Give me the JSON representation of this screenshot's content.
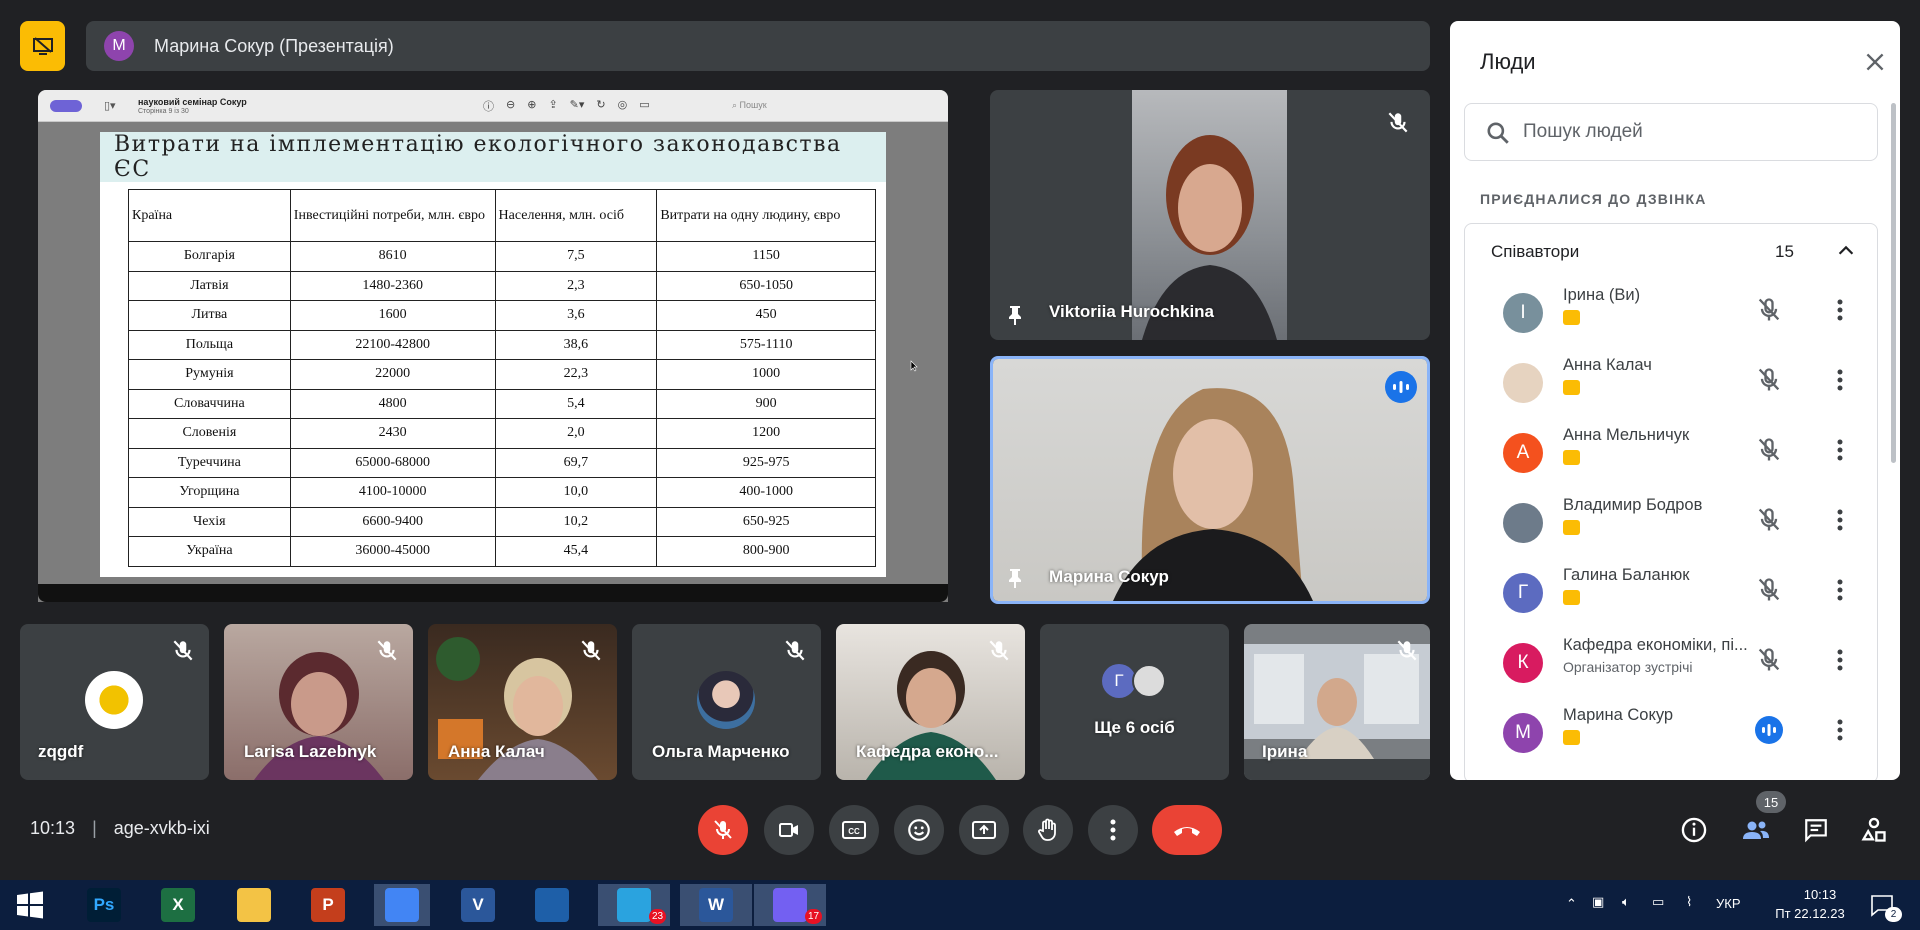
{
  "presentation": {
    "avatar_letter": "M",
    "presenter_label": "Марина Сокур (Презентація)"
  },
  "pdf": {
    "doc_title": "науковий семінар Сокур",
    "page_info": "Сторінка 9 із 30",
    "search_placeholder": "Пошук"
  },
  "slide": {
    "title": "Витрати на імплементацію екологічного законодавства ЄС",
    "headers": [
      "Країна",
      "Інвестиційні потреби, млн. євро",
      "Населення, млн. осіб",
      "Витрати на одну людину, євро"
    ],
    "rows": [
      [
        "Болгарія",
        "8610",
        "7,5",
        "1150"
      ],
      [
        "Латвія",
        "1480-2360",
        "2,3",
        "650-1050"
      ],
      [
        "Литва",
        "1600",
        "3,6",
        "450"
      ],
      [
        "Польща",
        "22100-42800",
        "38,6",
        "575-1110"
      ],
      [
        "Румунія",
        "22000",
        "22,3",
        "1000"
      ],
      [
        "Словаччина",
        "4800",
        "5,4",
        "900"
      ],
      [
        "Словенія",
        "2430",
        "2,0",
        "1200"
      ],
      [
        "Туреччина",
        "65000-68000",
        "69,7",
        "925-975"
      ],
      [
        "Угорщина",
        "4100-10000",
        "10,0",
        "400-1000"
      ],
      [
        "Чехія",
        "6600-9400",
        "10,2",
        "650-925"
      ],
      [
        "Україна",
        "36000-45000",
        "45,4",
        "800-900"
      ]
    ]
  },
  "tiles": {
    "viktoriia": "Viktoriia Hurochkina",
    "maryna": "Марина Сокур",
    "zqgdf": "zqgdf",
    "larisa": "Larisa Lazebnyk",
    "anna": "Анна Калач",
    "olga": "Ольга Марченко",
    "kafedra": "Кафедра еконо...",
    "more_letter": "Г",
    "more": "Ще 6 осіб",
    "iryna": "Ірина"
  },
  "people_panel": {
    "title": "Люди",
    "search_placeholder": "Пошук людей",
    "joined_label": "ПРИЄДНАЛИСЯ ДО ДЗВІНКА",
    "section_label": "Співавтори",
    "section_count": "15",
    "people": [
      {
        "letter": "І",
        "name": "Ірина (Ви)",
        "sub": "",
        "color": "#78909c"
      },
      {
        "letter": "",
        "name": "Анна Калач",
        "sub": "",
        "color": "#e6d3c0"
      },
      {
        "letter": "А",
        "name": "Анна Мельничук",
        "sub": "",
        "color": "#f4511e"
      },
      {
        "letter": "",
        "name": "Владимир Бодров",
        "sub": "",
        "color": "#6d7b8a"
      },
      {
        "letter": "Г",
        "name": "Галина Баланюк",
        "sub": "",
        "color": "#5c6bc0"
      },
      {
        "letter": "К",
        "name": "Кафедра економіки, пі...",
        "sub": "Організатор зустрічі",
        "color": "#d81b60"
      },
      {
        "letter": "М",
        "name": "Марина Сокур",
        "sub": "",
        "color": "#8e44ad"
      }
    ]
  },
  "meeting": {
    "time": "10:13",
    "separator": "|",
    "code": "age-xvkb-ixi",
    "people_count": "15"
  },
  "taskbar": {
    "apps": [
      {
        "name": "Ps",
        "color": "#001e36",
        "fg": "#31a8ff",
        "badge": ""
      },
      {
        "name": "X",
        "color": "#1d6f42",
        "fg": "#fff",
        "badge": ""
      },
      {
        "name": "",
        "color": "#f3c345",
        "fg": "#fff",
        "badge": ""
      },
      {
        "name": "P",
        "color": "#c43e1c",
        "fg": "#fff",
        "badge": ""
      },
      {
        "name": "",
        "color": "#4285f4",
        "fg": "#fff",
        "badge": ""
      },
      {
        "name": "V",
        "color": "#2b579a",
        "fg": "#fff",
        "badge": ""
      },
      {
        "name": "",
        "color": "#1e5fa8",
        "fg": "#fff",
        "badge": ""
      },
      {
        "name": "",
        "color": "#2aa3df",
        "fg": "#fff",
        "badge": "23"
      },
      {
        "name": "W",
        "color": "#2b579a",
        "fg": "#fff",
        "badge": ""
      },
      {
        "name": "",
        "color": "#7360f2",
        "fg": "#fff",
        "badge": "17"
      }
    ],
    "lang": "УКР",
    "clock_time": "10:13",
    "clock_date": "Пт 22.12.23",
    "notif_count": "2"
  }
}
